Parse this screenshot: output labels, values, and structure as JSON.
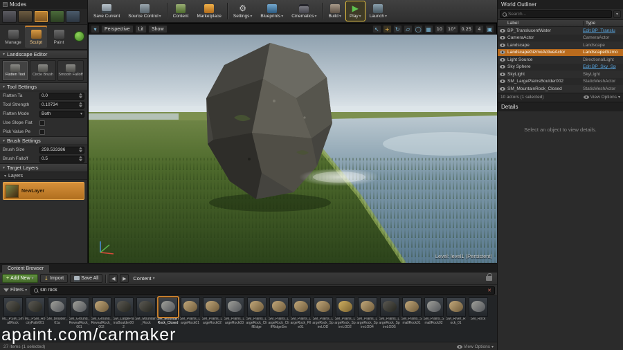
{
  "colors": {
    "accent-orange": "#c8802e",
    "selection-orange": "#b96b1d",
    "link-blue": "#58a6e0",
    "play-green": "#4caf50",
    "highlight-yellow": "#e8c33d"
  },
  "window": {
    "watermark": "apaint.com/carmaker"
  },
  "modes_panel": {
    "title": "Modes",
    "mode_icons": [
      "place-mode-icon",
      "paint-mode-icon",
      "landscape-mode-icon",
      "foliage-mode-icon",
      "geometry-mode-icon"
    ],
    "tabs": [
      {
        "label": "Manage"
      },
      {
        "label": "Sculpt"
      },
      {
        "label": "Paint"
      }
    ],
    "active_tab": "Sculpt",
    "section_title": "Landscape Editor",
    "tools": [
      {
        "label": "Flatten Tool"
      },
      {
        "label": "Circle Brush"
      },
      {
        "label": "Smooth Falloff"
      }
    ],
    "tool_settings": {
      "title": "Tool Settings",
      "flatten_target_label": "Flatten Ta",
      "flatten_target_value": "0.0",
      "tool_strength_label": "Tool Strength",
      "tool_strength_value": "0.10734",
      "flatten_mode_label": "Flatten Mode",
      "flatten_mode_value": "Both",
      "use_slope_label": "Use Slope Flat",
      "pick_value_label": "Pick Value Pe"
    },
    "brush_settings": {
      "title": "Brush Settings",
      "brush_size_label": "Brush Size",
      "brush_size_value": "259.533386",
      "brush_falloff_label": "Brush Falloff",
      "brush_falloff_value": "0.5"
    },
    "target_layers": {
      "title": "Target Layers",
      "layers_label": "Layers",
      "layer_name": "NewLayer"
    }
  },
  "toolbar": {
    "save_current": "Save Current",
    "source_control": "Source Control",
    "content": "Content",
    "marketplace": "Marketplace",
    "settings": "Settings",
    "blueprints": "Blueprints",
    "cinematics": "Cinematics",
    "build": "Build",
    "play": "Play",
    "launch": "Launch"
  },
  "viewport": {
    "perspective": "Perspective",
    "lit": "Lit",
    "show": "Show",
    "grid_snap": "10",
    "angle_snap": "10°",
    "scale_snap": "0.25",
    "camera_speed": "4",
    "level_text": "Level: level1 (Persistent)"
  },
  "world_outliner": {
    "title": "World Outliner",
    "search_placeholder": "Search...",
    "col_label": "Label",
    "col_type": "Type",
    "rows": [
      {
        "label": "BP_TranslucentWater",
        "type": "Edit BP_Translu",
        "link": true
      },
      {
        "label": "CameraActor",
        "type": "CameraActor"
      },
      {
        "label": "Landscape",
        "type": "Landscape"
      },
      {
        "label": "LandscapeGizmoActiveActor",
        "type": "LandscapeGizmo",
        "selected": true
      },
      {
        "label": "Light Source",
        "type": "DirectionalLight"
      },
      {
        "label": "Sky Sphere",
        "type": "Edit BP_Sky_Sp",
        "link": true
      },
      {
        "label": "SkyLight",
        "type": "SkyLight"
      },
      {
        "label": "SM_LargePlainsBoulder002",
        "type": "StaticMeshActor"
      },
      {
        "label": "SM_MountainRock_Closed",
        "type": "StaticMeshActor"
      }
    ],
    "footer": "10 actors (1 selected)",
    "view_options": "View Options"
  },
  "details_panel": {
    "title": "Details",
    "empty_text": "Select an object to view details."
  },
  "content_browser": {
    "tab_title": "Content Browser",
    "add_new": "Add New",
    "import": "Import",
    "save_all": "Save All",
    "path": "Content",
    "filters": "Filters",
    "search_value": "sm rock",
    "items": [
      {
        "name": "ML_PSM_SmallRock",
        "tone": "dark"
      },
      {
        "name": "ML_PSM_RockyPath001",
        "tone": "dark"
      },
      {
        "name": "SM_Boulder_01a",
        "tone": "gray"
      },
      {
        "name": "SM_Ground_RevealRock_001",
        "tone": "gray"
      },
      {
        "name": "SM_Ground_RevealRock_002",
        "tone": "tan"
      },
      {
        "name": "SM_LargePlainsBoulder002",
        "tone": "dark"
      },
      {
        "name": "SM_Mountain_Rock",
        "tone": "dark"
      },
      {
        "name": "SM_MountainRock_Closed",
        "tone": "gray",
        "selected": true
      },
      {
        "name": "SM_Plains_LargeRock01",
        "tone": "tan"
      },
      {
        "name": "SM_Plains_LargeRock02",
        "tone": "tan"
      },
      {
        "name": "SM_Plains_LargeRock03",
        "tone": "gray"
      },
      {
        "name": "SM_Plains_LargeRock_CliffEdge",
        "tone": "tan"
      },
      {
        "name": "SM_Plains_LargeRock_CliffRidgeSm",
        "tone": "tan"
      },
      {
        "name": "SM_Plains_LargeRock_Pile01",
        "tone": "tan"
      },
      {
        "name": "SM_Plains_LargeRock_SpireLOD",
        "tone": "tan"
      },
      {
        "name": "SM_Plains_LargeRock_SpireLOD2",
        "tone": "gold"
      },
      {
        "name": "SM_Plains_LargeRock_SpireLOD4",
        "tone": "tan"
      },
      {
        "name": "SM_Plains_LargeRock_SpireLOD5",
        "tone": "dark"
      },
      {
        "name": "SM_Plains_SmallRock01",
        "tone": "tan"
      },
      {
        "name": "SM_Plains_SmallRock02",
        "tone": "gray"
      },
      {
        "name": "SM_River_Rock_01",
        "tone": "tan"
      },
      {
        "name": "SM_Rock",
        "tone": "gray"
      }
    ],
    "footer": "27 items (1 selected)",
    "view_options": "View Options"
  }
}
